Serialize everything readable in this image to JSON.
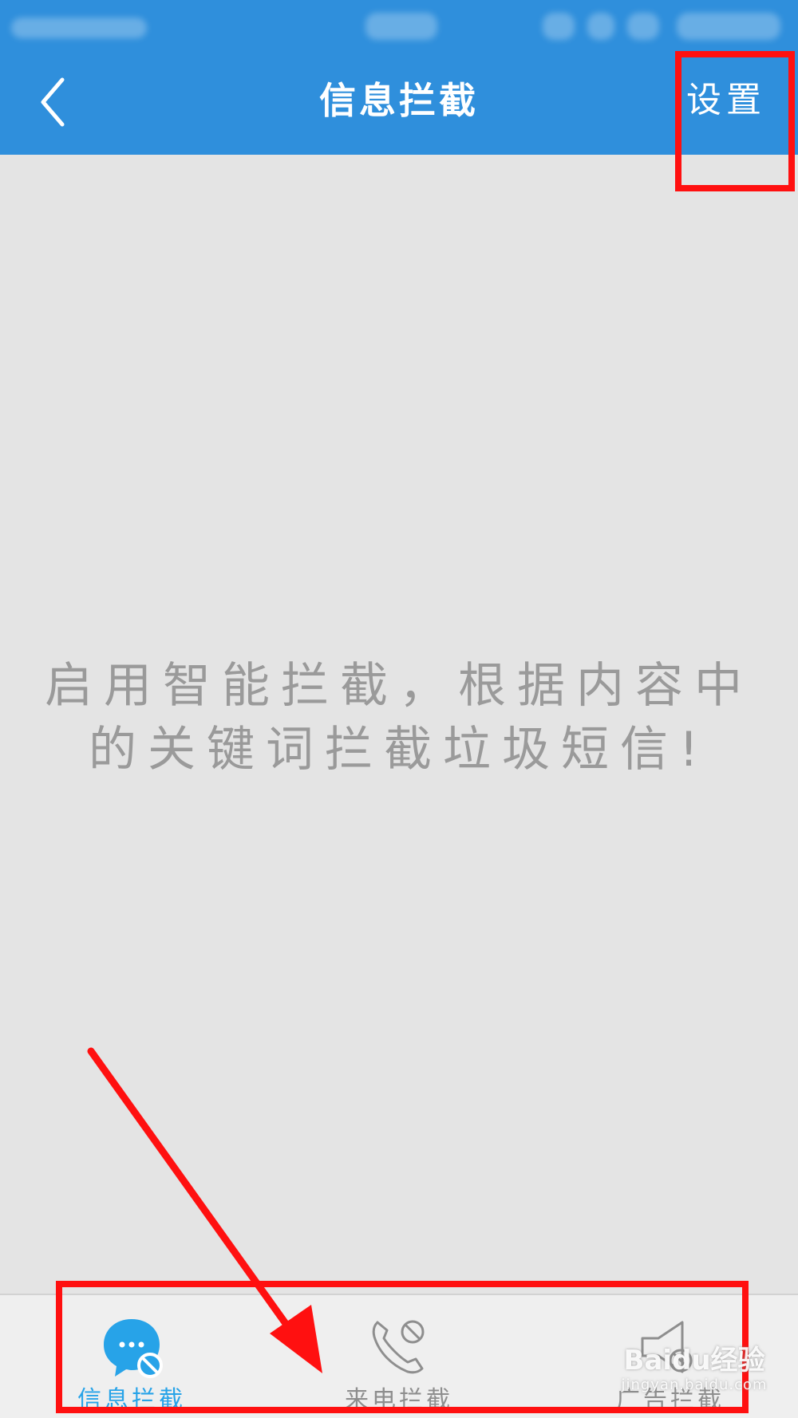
{
  "header": {
    "title": "信息拦截",
    "settings_label": "设置",
    "back_icon": "chevron-left-icon"
  },
  "main": {
    "empty_message_line1": "启用智能拦截，根据内容中",
    "empty_message_line2": "的关键词拦截垃圾短信!"
  },
  "tabs": [
    {
      "label": "信息拦截",
      "icon": "message-block-icon",
      "active": true
    },
    {
      "label": "来电拦截",
      "icon": "phone-block-icon",
      "active": false
    },
    {
      "label": "广告拦截",
      "icon": "speaker-block-icon",
      "active": false
    }
  ],
  "watermark": {
    "main": "Baidu经验",
    "sub": "jingyan.baidu.com"
  },
  "colors": {
    "header_bg": "#2f8fdc",
    "active_tab": "#27a3e8",
    "inactive_tab": "#8e8e8e",
    "annotation": "#ff1010",
    "background": "#e4e4e4"
  }
}
